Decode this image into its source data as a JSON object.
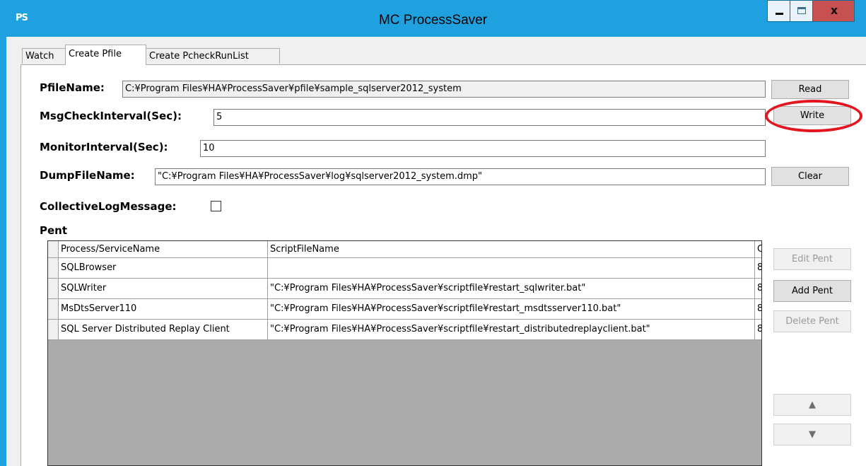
{
  "window": {
    "title": "MC ProcessSaver",
    "icon_text": "PS",
    "close_glyph": "x"
  },
  "tabs": [
    {
      "label": "Watch"
    },
    {
      "label": "Create Pfile"
    },
    {
      "label": "Create PcheckRunList"
    }
  ],
  "form": {
    "pfile_label": "PfileName:",
    "pfile_value": "C:¥Program Files¥HA¥ProcessSaver¥pfile¥sample_sqlserver2012_system",
    "msg_label": "MsgCheckInterval(Sec):",
    "msg_value": "5",
    "monitor_label": "MonitorInterval(Sec):",
    "monitor_value": "10",
    "dump_label": "DumpFileName:",
    "dump_value": "\"C:¥Program Files¥HA¥ProcessSaver¥log¥sqlserver2012_system.dmp\"",
    "collective_label": "CollectiveLogMessage:",
    "collective_checked": false,
    "pent_label": "Pent"
  },
  "buttons": {
    "read": "Read",
    "write": "Write",
    "clear": "Clear",
    "edit_pent": "Edit Pent",
    "add_pent": "Add Pent",
    "delete_pent": "Delete Pent",
    "up": "▲",
    "down": "▼"
  },
  "grid": {
    "headers": [
      "Process/ServiceName",
      "ScriptFileName",
      "C"
    ],
    "rows": [
      {
        "name": "SQLBrowser",
        "script": "",
        "c": "8"
      },
      {
        "name": "SQLWriter",
        "script": "\"C:¥Program Files¥HA¥ProcessSaver¥scriptfile¥restart_sqlwriter.bat\"",
        "c": "8"
      },
      {
        "name": "MsDtsServer110",
        "script": "\"C:¥Program Files¥HA¥ProcessSaver¥scriptfile¥restart_msdtsserver110.bat\"",
        "c": "8"
      },
      {
        "name": "SQL Server Distributed Replay Client",
        "script": "\"C:¥Program Files¥HA¥ProcessSaver¥scriptfile¥restart_distributedreplayclient.bat\"",
        "c": "8"
      }
    ]
  },
  "colors": {
    "titlebar": "#1fa0df",
    "close_button": "#c75050",
    "highlight": "#e4151f"
  }
}
